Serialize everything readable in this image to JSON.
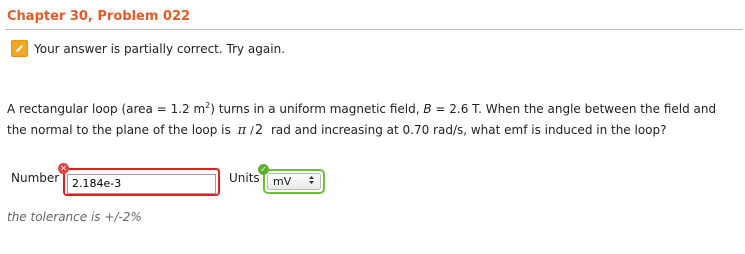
{
  "header": {
    "title": "Chapter 30, Problem 022"
  },
  "status": {
    "message": "Your answer is partially correct.  Try again.",
    "icon": "pencil-icon"
  },
  "question": {
    "part1": "A rectangular loop (area = 1.2 m",
    "area_exp": "2",
    "part2": ") turns in a uniform magnetic field, ",
    "var_b": "B",
    "part3": " = 2.6 T. When the angle between the field and",
    "part4": "the normal to the plane of the loop is ",
    "pi": "π",
    "slash": "/",
    "two": "2",
    "part5": " rad and increasing at 0.70 rad/s, what emf is induced in the loop?"
  },
  "answer": {
    "number_label": "Number",
    "number_value": "2.184e-3",
    "number_status": "incorrect",
    "units_label": "Units",
    "units_value": "mV",
    "units_status": "correct",
    "units_arrows": "▲▼"
  },
  "tolerance": "the tolerance is +/-2%",
  "colors": {
    "title": "#e35b25",
    "error": "#d9251d",
    "success": "#6bbf3a",
    "pencil": "#f3a623"
  }
}
